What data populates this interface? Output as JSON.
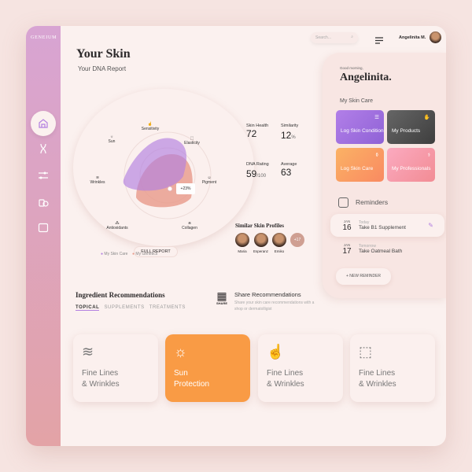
{
  "brand": "GENEIUM",
  "header": {
    "search_placeholder": "Search...",
    "user_name": "Angelinita M."
  },
  "skin": {
    "title": "Your Skin",
    "subtitle": "Your DNA Report"
  },
  "radar": {
    "axes": [
      "Sensitivity",
      "Elasticity",
      "Pigment",
      "Collagen",
      "Antioxidants",
      "Wrinkles",
      "Sun"
    ],
    "badge": "+23%",
    "full_report": "FULL REPORT",
    "legend": [
      {
        "label": "My Skin Care",
        "color": "#b27fe0"
      },
      {
        "label": "My Genetics",
        "color": "#e89a8a"
      }
    ]
  },
  "stats": [
    {
      "label": "Skin Health",
      "value": "72",
      "unit": ""
    },
    {
      "label": "Similarity",
      "value": "12",
      "unit": "%"
    },
    {
      "label": "DNA Rating",
      "value": "59",
      "unit": "/100"
    },
    {
      "label": "Average",
      "value": "63",
      "unit": ""
    }
  ],
  "similar": {
    "title": "Similar Skin Profiles",
    "profiles": [
      "Maria",
      "Esperanz",
      "Emiko"
    ],
    "more": "+17"
  },
  "panel": {
    "greeting": "Good morning,",
    "name": "Angelinita.",
    "section": "My Skin Care",
    "tiles": [
      {
        "label": "Log Skin Condition",
        "icon": "sliders-icon"
      },
      {
        "label": "My Products",
        "icon": "hand-globe-icon"
      },
      {
        "label": "Log Skin Care",
        "icon": "bottle-icon"
      },
      {
        "label": "My Professionals",
        "icon": "stethoscope-icon"
      }
    ],
    "reminders_title": "Reminders",
    "reminders": [
      {
        "month": "JAN",
        "day": "16",
        "when": "Today",
        "text": "Take B1 Supplement"
      },
      {
        "month": "JAN",
        "day": "17",
        "when": "Tomorrow",
        "text": "Take Oatmeal Bath"
      }
    ],
    "new_reminder": "+ NEW REMINDER"
  },
  "ingredients": {
    "title": "Ingredient Recommendations",
    "tabs": [
      "TOPICAL",
      "SUPPLEMENTS",
      "TREATMENTS"
    ],
    "active_tab": "TOPICAL"
  },
  "share": {
    "qr_label": "SHARE",
    "title": "Share Recommendations",
    "text": "Share your skin care recommendations with a shop or dermatolligist"
  },
  "cards": [
    {
      "line1": "Fine Lines",
      "line2": "& Wrinkles",
      "icon": "waves-icon"
    },
    {
      "line1": "Sun",
      "line2": "Protection",
      "icon": "sun-icon",
      "active": true
    },
    {
      "line1": "Fine Lines",
      "line2": "& Wrinkles",
      "icon": "touch-icon"
    },
    {
      "line1": "Fine Lines",
      "line2": "& Wrinkles",
      "icon": "elasticity-icon"
    }
  ],
  "colors": {
    "accent": "#b27fe0",
    "orange": "#f9a24a",
    "sidebar": "#d8a4d3"
  }
}
